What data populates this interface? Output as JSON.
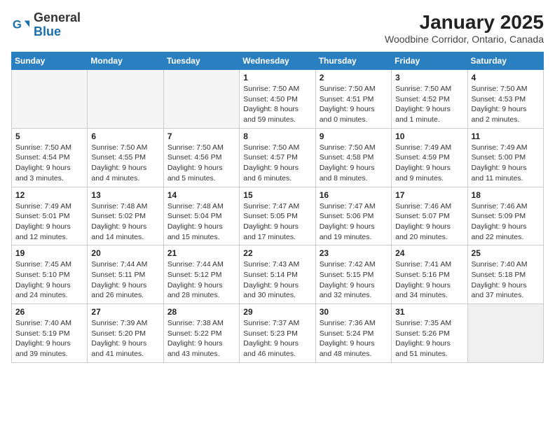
{
  "header": {
    "logo_general": "General",
    "logo_blue": "Blue",
    "month_title": "January 2025",
    "location": "Woodbine Corridor, Ontario, Canada"
  },
  "days_of_week": [
    "Sunday",
    "Monday",
    "Tuesday",
    "Wednesday",
    "Thursday",
    "Friday",
    "Saturday"
  ],
  "weeks": [
    [
      {
        "day": "",
        "info": ""
      },
      {
        "day": "",
        "info": ""
      },
      {
        "day": "",
        "info": ""
      },
      {
        "day": "1",
        "info": "Sunrise: 7:50 AM\nSunset: 4:50 PM\nDaylight: 8 hours and 59 minutes."
      },
      {
        "day": "2",
        "info": "Sunrise: 7:50 AM\nSunset: 4:51 PM\nDaylight: 9 hours and 0 minutes."
      },
      {
        "day": "3",
        "info": "Sunrise: 7:50 AM\nSunset: 4:52 PM\nDaylight: 9 hours and 1 minute."
      },
      {
        "day": "4",
        "info": "Sunrise: 7:50 AM\nSunset: 4:53 PM\nDaylight: 9 hours and 2 minutes."
      }
    ],
    [
      {
        "day": "5",
        "info": "Sunrise: 7:50 AM\nSunset: 4:54 PM\nDaylight: 9 hours and 3 minutes."
      },
      {
        "day": "6",
        "info": "Sunrise: 7:50 AM\nSunset: 4:55 PM\nDaylight: 9 hours and 4 minutes."
      },
      {
        "day": "7",
        "info": "Sunrise: 7:50 AM\nSunset: 4:56 PM\nDaylight: 9 hours and 5 minutes."
      },
      {
        "day": "8",
        "info": "Sunrise: 7:50 AM\nSunset: 4:57 PM\nDaylight: 9 hours and 6 minutes."
      },
      {
        "day": "9",
        "info": "Sunrise: 7:50 AM\nSunset: 4:58 PM\nDaylight: 9 hours and 8 minutes."
      },
      {
        "day": "10",
        "info": "Sunrise: 7:49 AM\nSunset: 4:59 PM\nDaylight: 9 hours and 9 minutes."
      },
      {
        "day": "11",
        "info": "Sunrise: 7:49 AM\nSunset: 5:00 PM\nDaylight: 9 hours and 11 minutes."
      }
    ],
    [
      {
        "day": "12",
        "info": "Sunrise: 7:49 AM\nSunset: 5:01 PM\nDaylight: 9 hours and 12 minutes."
      },
      {
        "day": "13",
        "info": "Sunrise: 7:48 AM\nSunset: 5:02 PM\nDaylight: 9 hours and 14 minutes."
      },
      {
        "day": "14",
        "info": "Sunrise: 7:48 AM\nSunset: 5:04 PM\nDaylight: 9 hours and 15 minutes."
      },
      {
        "day": "15",
        "info": "Sunrise: 7:47 AM\nSunset: 5:05 PM\nDaylight: 9 hours and 17 minutes."
      },
      {
        "day": "16",
        "info": "Sunrise: 7:47 AM\nSunset: 5:06 PM\nDaylight: 9 hours and 19 minutes."
      },
      {
        "day": "17",
        "info": "Sunrise: 7:46 AM\nSunset: 5:07 PM\nDaylight: 9 hours and 20 minutes."
      },
      {
        "day": "18",
        "info": "Sunrise: 7:46 AM\nSunset: 5:09 PM\nDaylight: 9 hours and 22 minutes."
      }
    ],
    [
      {
        "day": "19",
        "info": "Sunrise: 7:45 AM\nSunset: 5:10 PM\nDaylight: 9 hours and 24 minutes."
      },
      {
        "day": "20",
        "info": "Sunrise: 7:44 AM\nSunset: 5:11 PM\nDaylight: 9 hours and 26 minutes."
      },
      {
        "day": "21",
        "info": "Sunrise: 7:44 AM\nSunset: 5:12 PM\nDaylight: 9 hours and 28 minutes."
      },
      {
        "day": "22",
        "info": "Sunrise: 7:43 AM\nSunset: 5:14 PM\nDaylight: 9 hours and 30 minutes."
      },
      {
        "day": "23",
        "info": "Sunrise: 7:42 AM\nSunset: 5:15 PM\nDaylight: 9 hours and 32 minutes."
      },
      {
        "day": "24",
        "info": "Sunrise: 7:41 AM\nSunset: 5:16 PM\nDaylight: 9 hours and 34 minutes."
      },
      {
        "day": "25",
        "info": "Sunrise: 7:40 AM\nSunset: 5:18 PM\nDaylight: 9 hours and 37 minutes."
      }
    ],
    [
      {
        "day": "26",
        "info": "Sunrise: 7:40 AM\nSunset: 5:19 PM\nDaylight: 9 hours and 39 minutes."
      },
      {
        "day": "27",
        "info": "Sunrise: 7:39 AM\nSunset: 5:20 PM\nDaylight: 9 hours and 41 minutes."
      },
      {
        "day": "28",
        "info": "Sunrise: 7:38 AM\nSunset: 5:22 PM\nDaylight: 9 hours and 43 minutes."
      },
      {
        "day": "29",
        "info": "Sunrise: 7:37 AM\nSunset: 5:23 PM\nDaylight: 9 hours and 46 minutes."
      },
      {
        "day": "30",
        "info": "Sunrise: 7:36 AM\nSunset: 5:24 PM\nDaylight: 9 hours and 48 minutes."
      },
      {
        "day": "31",
        "info": "Sunrise: 7:35 AM\nSunset: 5:26 PM\nDaylight: 9 hours and 51 minutes."
      },
      {
        "day": "",
        "info": ""
      }
    ]
  ]
}
